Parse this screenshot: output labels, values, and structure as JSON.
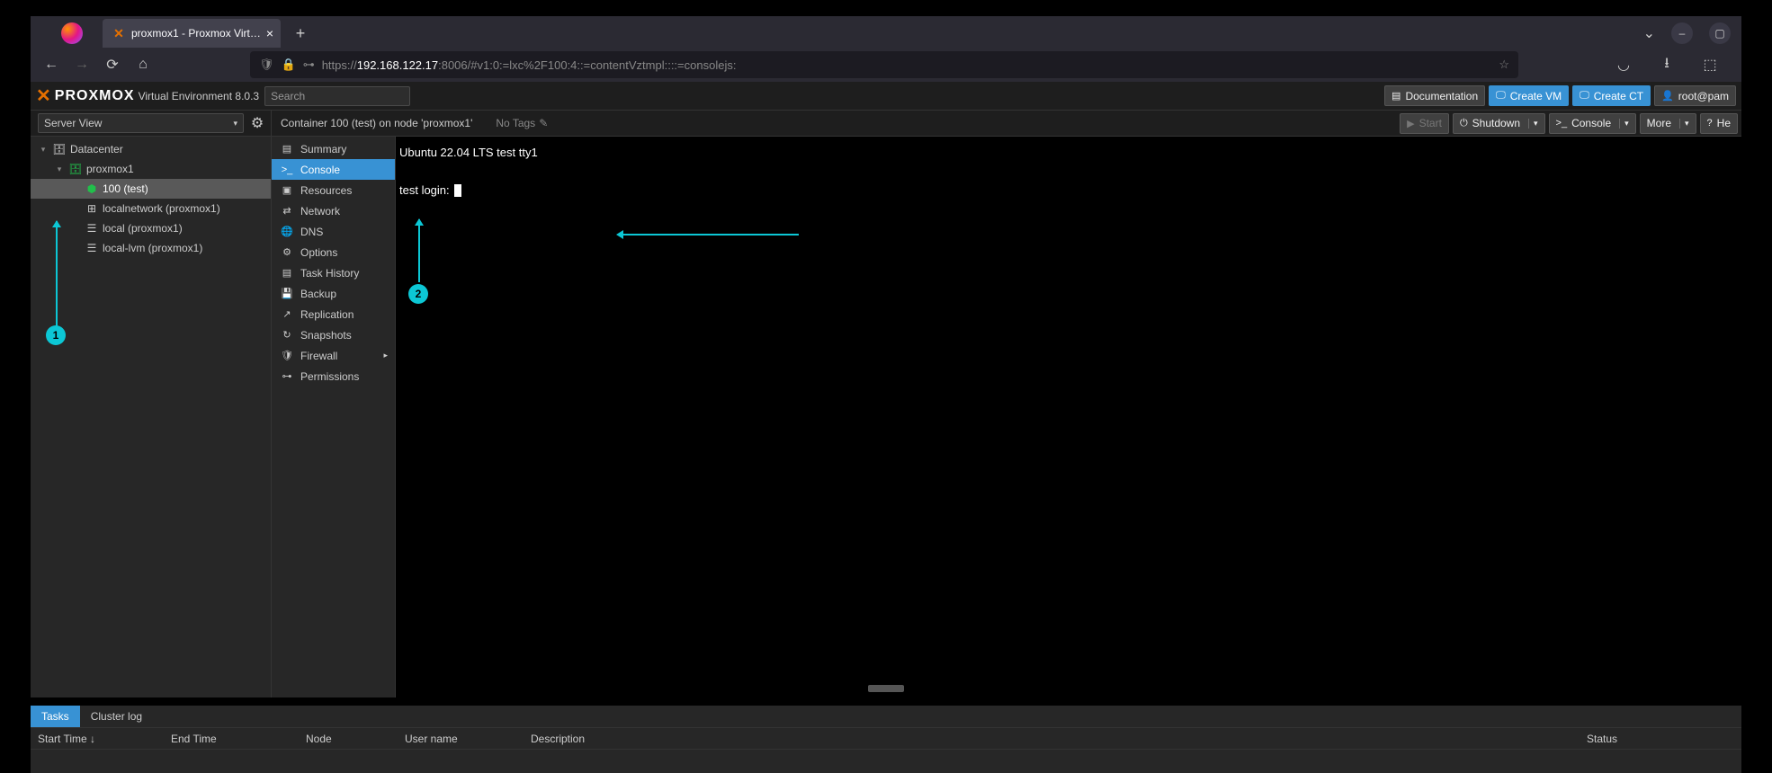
{
  "browser": {
    "tab_title": "proxmox1 - Proxmox Virt…",
    "url_proto": "https://",
    "url_host": "192.168.122.17",
    "url_path": ":8006/#v1:0:=lxc%2F100:4::=contentVztmpl::::=consolejs:"
  },
  "header": {
    "logo_text": "PROXMOX",
    "ve_label": "Virtual Environment 8.0.3",
    "search_placeholder": "Search",
    "buttons": {
      "docs": "Documentation",
      "create_vm": "Create VM",
      "create_ct": "Create CT",
      "user": "root@pam"
    }
  },
  "toolbar": {
    "view": "Server View",
    "crumb": "Container 100 (test) on node 'proxmox1'",
    "no_tags": "No Tags",
    "start": "Start",
    "shutdown": "Shutdown",
    "console": "Console",
    "more": "More",
    "help": "He"
  },
  "tree": {
    "datacenter": "Datacenter",
    "node": "proxmox1",
    "ct": "100 (test)",
    "localnet": "localnetwork (proxmox1)",
    "local": "local (proxmox1)",
    "lvm": "local-lvm (proxmox1)"
  },
  "vnav": {
    "summary": "Summary",
    "console": "Console",
    "resources": "Resources",
    "network": "Network",
    "dns": "DNS",
    "options": "Options",
    "task_history": "Task History",
    "backup": "Backup",
    "replication": "Replication",
    "snapshots": "Snapshots",
    "firewall": "Firewall",
    "permissions": "Permissions"
  },
  "console_out": {
    "line1": "Ubuntu 22.04 LTS test tty1",
    "line2": "test login: "
  },
  "bottom": {
    "tab_tasks": "Tasks",
    "tab_cluster": "Cluster log",
    "col_start": "Start Time ↓",
    "col_end": "End Time",
    "col_node": "Node",
    "col_user": "User name",
    "col_desc": "Description",
    "col_status": "Status"
  },
  "annotations": {
    "b1": "1",
    "b2": "2"
  }
}
